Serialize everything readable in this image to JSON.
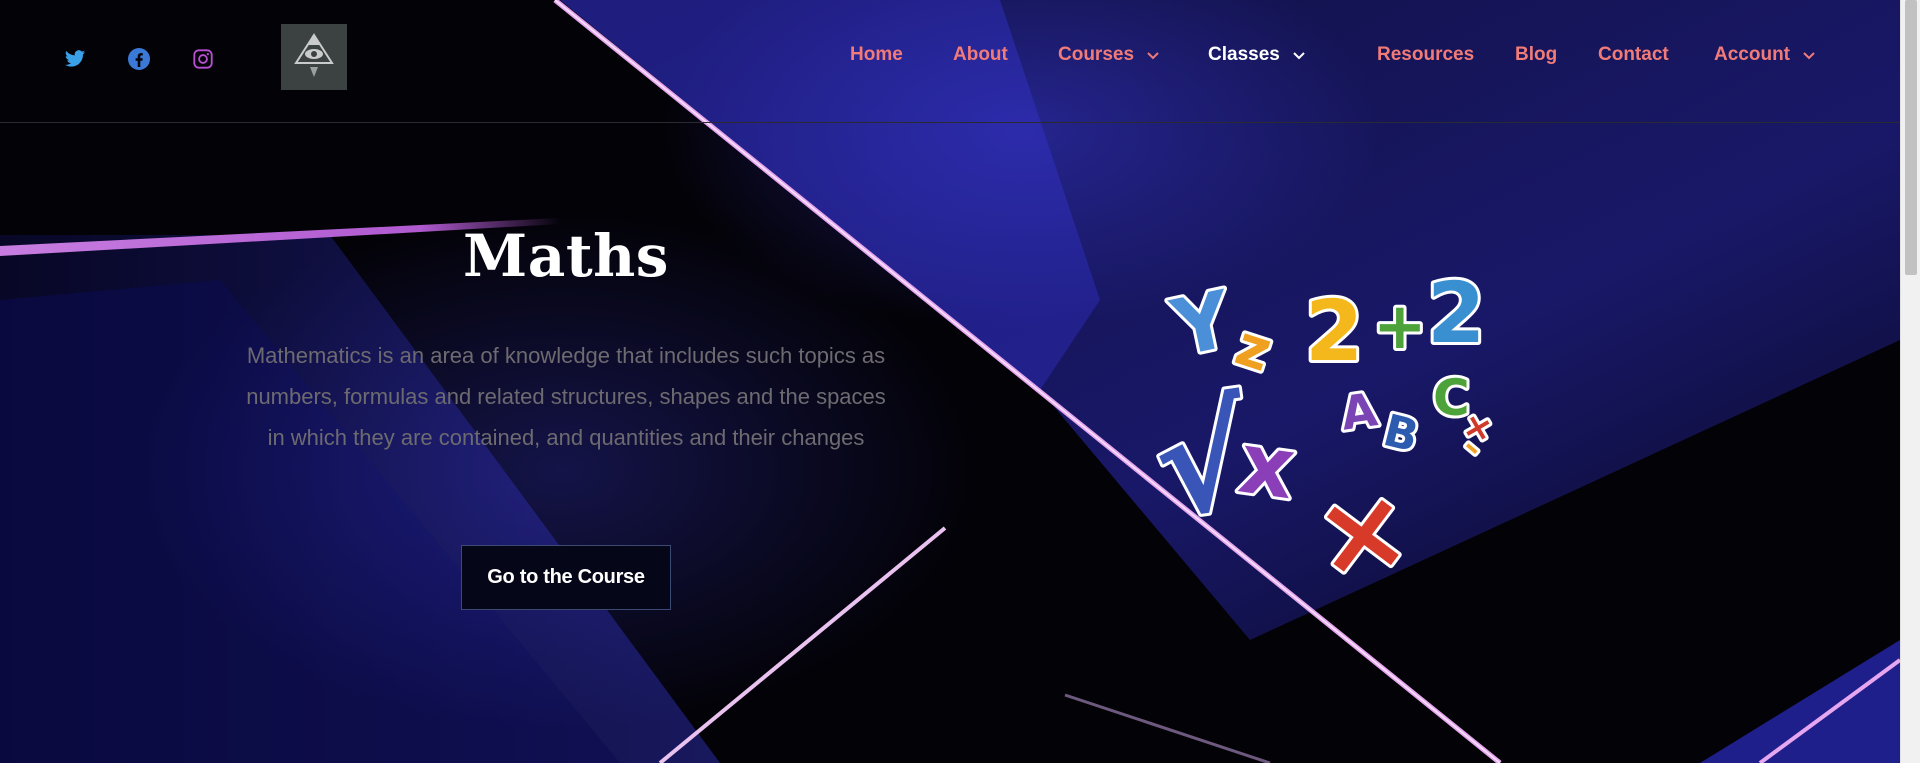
{
  "social": [
    {
      "icon": "twitter-icon",
      "color": "#3aa1e8"
    },
    {
      "icon": "facebook-icon",
      "color": "#3b79d6"
    },
    {
      "icon": "instagram-icon",
      "color": "#b84fd4"
    }
  ],
  "nav": {
    "home": "Home",
    "about": "About",
    "courses": "Courses",
    "classes": "Classes",
    "resources": "Resources",
    "blog": "Blog",
    "contact": "Contact",
    "account": "Account"
  },
  "hero": {
    "title": "Maths",
    "description": "Mathematics is an area of knowledge that includes such topics as numbers, formulas and related structures, shapes and the spaces in which they are contained, and quantities and their changes",
    "cta": "Go to the Course"
  },
  "colors": {
    "nav_link": "#f07b78",
    "nav_active": "#ffffff",
    "accent_line": "#e7a7f0"
  }
}
